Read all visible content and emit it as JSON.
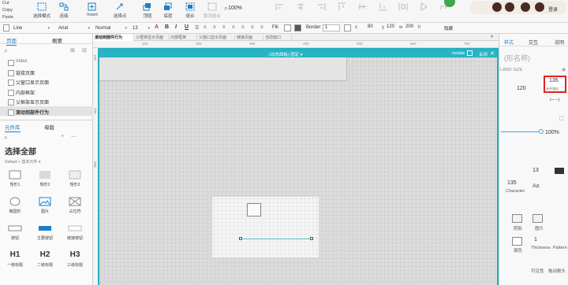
{
  "colors": {
    "accent": "#1a7fc8",
    "frame": "#22b0c0",
    "highlight_box": "#e02020"
  },
  "clipboard": {
    "cut": "Cut",
    "copy": "Copy",
    "paste": "Paste"
  },
  "toolbar": {
    "select_mode": "选择模式",
    "connect": "连接",
    "insert": "Insert",
    "snap": "选择点",
    "top": "顶层",
    "bottom": "底层",
    "group": "组合",
    "ungroup": "取消组合",
    "zoom": "100%",
    "login": "登录"
  },
  "format": {
    "line_style": "Line",
    "font": "Arial",
    "weight": "Normal",
    "size": "13",
    "fill_label": "Fill",
    "border_label": "Border:",
    "border_value": "1",
    "x": "80",
    "y": "120",
    "w": "200",
    "h": "",
    "hidden_label": "隐藏"
  },
  "left": {
    "tabs": [
      "页面",
      "概要"
    ],
    "pages": [
      "Index",
      "链接页面",
      "父窗口显示页面",
      "内部框架",
      "父框架显示页面",
      "滚动到部件行为"
    ],
    "lib_tabs": [
      "元件库",
      "母版"
    ],
    "lib_select": "选择全部",
    "lib_sub": "Default > 基本元件 ▾",
    "widgets": [
      {
        "label": "矩形1",
        "icon": "rectangle-icon"
      },
      {
        "label": "矩形2",
        "icon": "rectangle-grey-icon"
      },
      {
        "label": "矩形3",
        "icon": "rectangle-shadow-icon"
      },
      {
        "label": "椭圆形",
        "icon": "ellipse-icon"
      },
      {
        "label": "图片",
        "icon": "image-icon"
      },
      {
        "label": "占位符",
        "icon": "placeholder-icon"
      },
      {
        "label": "按钮",
        "icon": "button-icon"
      },
      {
        "label": "主要按钮",
        "icon": "primary-button-icon"
      },
      {
        "label": "链接按钮",
        "icon": "link-button-icon"
      },
      {
        "label": "一级标题",
        "icon": "h1-icon",
        "glyph": "H1"
      },
      {
        "label": "二级标题",
        "icon": "h2-icon",
        "glyph": "H2"
      },
      {
        "label": "三级标题",
        "icon": "h3-icon",
        "glyph": "H3"
      }
    ]
  },
  "canvas": {
    "tabs": [
      "滚动到部件行为",
      "父框架显示页面",
      "内部框架",
      "父窗口显示页面",
      "链接页面",
      "当前窗口"
    ],
    "frame_title": "(动态面板) 固定 ▾",
    "frame_isolate": "Isolate",
    "frame_close": "关闭",
    "ruler_h": [
      "100",
      "200",
      "300",
      "400",
      "500",
      "600",
      "700"
    ],
    "ruler_v": [
      "100",
      "200",
      "300"
    ]
  },
  "right": {
    "tabs": [
      "样式",
      "交互",
      "说明"
    ],
    "name_placeholder": "(形名称)",
    "land_size": "LAND SIZE",
    "y_value": "120",
    "w_value": "135",
    "w_hint": "允许溢出",
    "opacity": "100%",
    "font_size": "13",
    "char_spacing": "135",
    "char_label": "Character",
    "shadow_labels": [
      "阴影",
      "图片"
    ],
    "thickness_value": "1",
    "thickness_label": "Thickness",
    "pattern_label": "Pattern",
    "fill_labels": [
      "填色",
      "可见性",
      "拖动箭头"
    ]
  }
}
